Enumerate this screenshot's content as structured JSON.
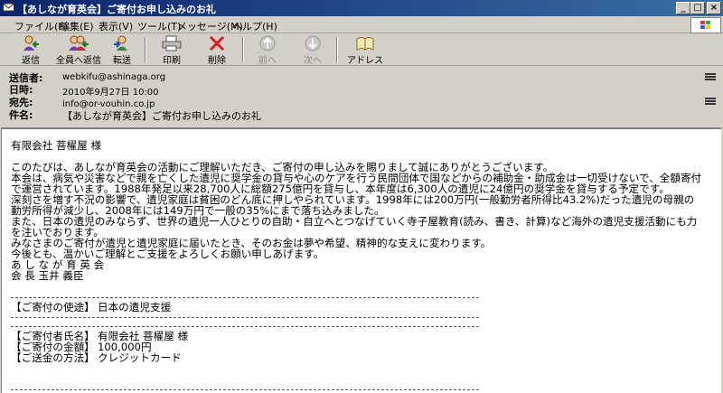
{
  "window": {
    "title": "【あしなが育英会】ご寄付お申し込みのお礼",
    "minimize": "_",
    "maximize": "□",
    "close": "×"
  },
  "menu": [
    "ファイル(F)",
    "編集(E)",
    "表示(V)",
    "ツール(T)",
    "メッセージ(M)",
    "ヘルプ(H)"
  ],
  "toolbar": {
    "reply": "返信",
    "reply_all": "全員へ返信",
    "forward": "転送",
    "print": "印刷",
    "delete": "削除",
    "prev": "前へ",
    "next": "次へ",
    "address": "アドレス"
  },
  "header": {
    "from_label": "送信者:",
    "from": "webkifu@ashinaga.org",
    "date_label": "日時:",
    "date": "2010年9月27日 10:00",
    "to_label": "宛先:",
    "to": "info@or-vouhin.co.jp",
    "subject_label": "件名:",
    "subject": "【あしなが育英会】ご寄付お申し込みのお礼"
  },
  "body": {
    "lines": [
      "有限会社 菩櫂屋 様",
      "",
      "このたびは、あしなが育英会の活動にご理解いただき、ご寄付の申し込みを賜りまして誠にありがとうございます。",
      "本会は、病気や災害などで親を亡くした遺児に奨学金の貸与や心のケアを行う民間団体で国などからの補助金・助成金は一切受けないで、全額寄付",
      "で運営されています。1988年発足以来28,700人に総額275億円を貸与し、本年度は6,300人の遺児に24億円の奨学金を貸与する予定です。",
      "深刻さを増す不況の影響で、遺児家庭は貧困のどん底に押しやられています。1998年には200万円(一般勤労者所得比43.2%)だった遺児の母親の",
      "勤労所得が減少し、2008年には149万円で一般の35%にまで落ち込みました。",
      "また、日本の遺児のみならず、世界の遺児一人ひとりの自助・自立へとつなげていく寺子屋教育(読み、書き、計算)など海外の遺児支援活動にも力",
      "を注いでおります。",
      "みなさまのご寄付が遺児と遺児家庭に届いたとき、そのお金は夢や希望、精神的な支えに変わります。",
      "今後とも、温かいご理解とご支援をよろしくお願い申しあげます。",
      "あ し な が 育 英 会",
      "会 長  玉井 義臣"
    ],
    "purpose_label": "【ご寄付の使途】",
    "purpose_value": "日本の遺児支援",
    "donor_label": "【ご寄付者氏名】",
    "donor_value": "有限会社 菩櫂屋 様",
    "amount_label": "【ご寄付の金額】",
    "amount_value": "100,000円",
    "method_label": "【ご送金の方法】",
    "method_value": "クレジットカード"
  }
}
